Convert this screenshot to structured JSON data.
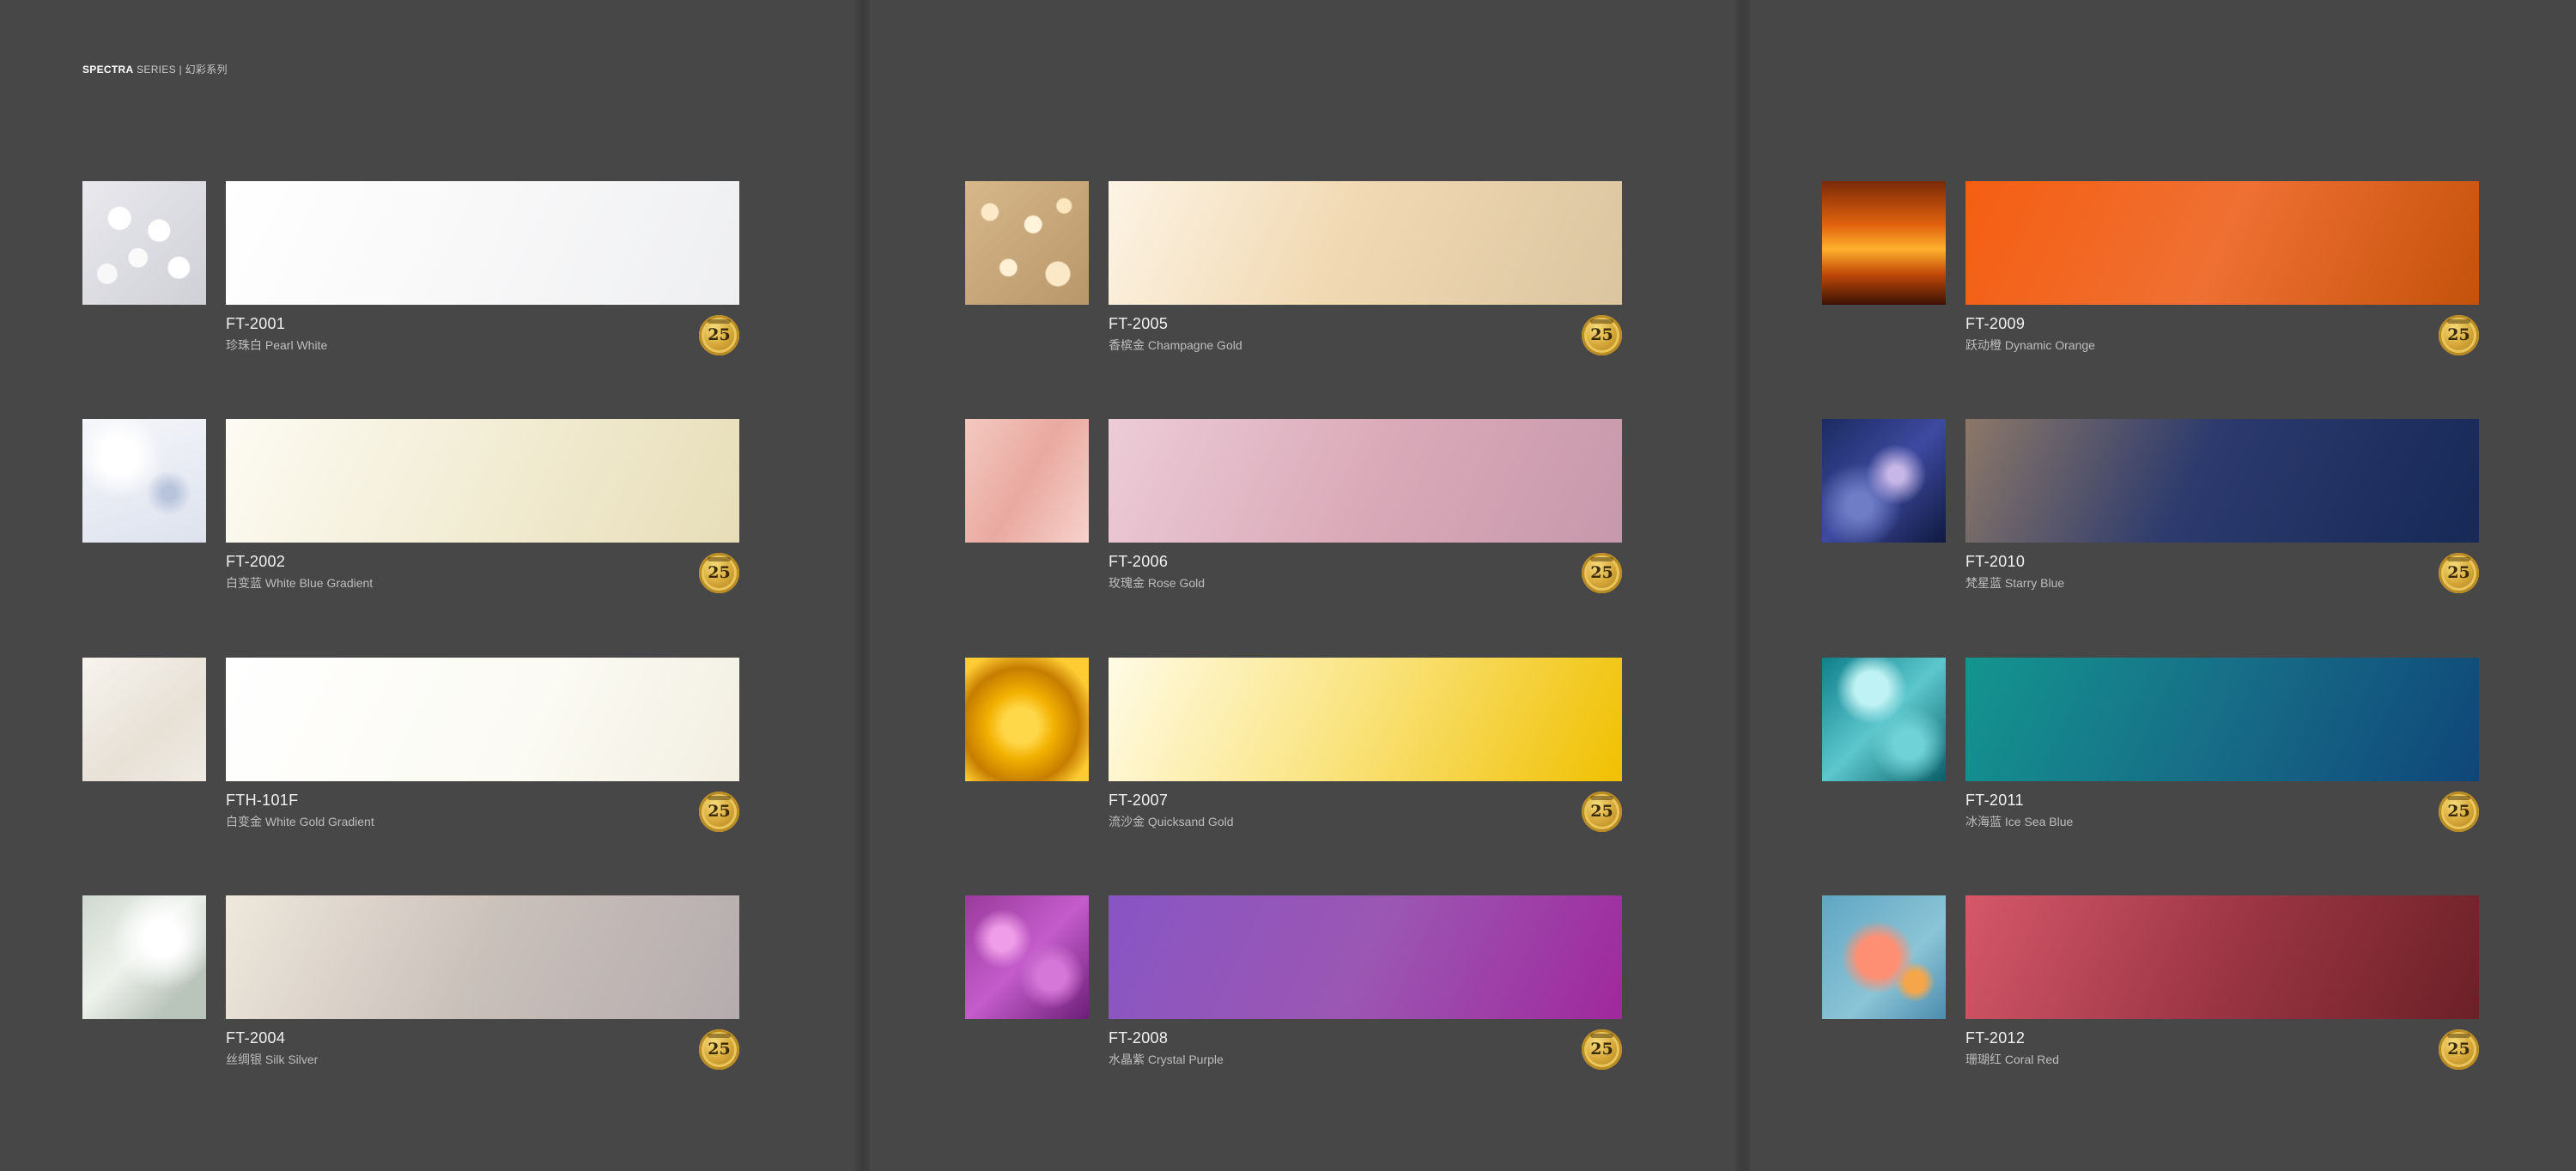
{
  "header": {
    "brand": "SPECTRA",
    "rest": "SERIES | 幻彩系列"
  },
  "badge_text": "25",
  "swatches": [
    {
      "code": "FT-2001",
      "name": "珍珠白 Pearl White",
      "colors": [
        "#ffffff",
        "#eeeff1"
      ]
    },
    {
      "code": "FT-2002",
      "name": "白变蓝 White Blue Gradient",
      "colors": [
        "#fdfbf3",
        "#e7ddb8"
      ]
    },
    {
      "code": "FTH-101F",
      "name": "白变金 White Gold Gradient",
      "colors": [
        "#ffffff",
        "#f2efe1"
      ]
    },
    {
      "code": "FT-2004",
      "name": "丝绸银 Silk Silver",
      "colors": [
        "#efe8dc",
        "#b5acae"
      ]
    },
    {
      "code": "FT-2005",
      "name": "香槟金 Champagne Gold",
      "colors": [
        "#fdf4e5",
        "#dac5a0"
      ]
    },
    {
      "code": "FT-2006",
      "name": "玫瑰金 Rose Gold",
      "colors": [
        "#ecccd7",
        "#c698ab"
      ]
    },
    {
      "code": "FT-2007",
      "name": "流沙金 Quicksand Gold",
      "colors": [
        "#fffbe6",
        "#f0c000"
      ]
    },
    {
      "code": "FT-2008",
      "name": "水晶紫 Crystal Purple",
      "colors": [
        "#8855c4",
        "#a0289c"
      ]
    },
    {
      "code": "FT-2009",
      "name": "跃动橙 Dynamic Orange",
      "colors": [
        "#f55e12",
        "#c4520b"
      ]
    },
    {
      "code": "FT-2010",
      "name": "梵星蓝 Starry Blue",
      "colors": [
        "#8c7868",
        "#162957"
      ]
    },
    {
      "code": "FT-2011",
      "name": "冰海蓝 Ice Sea Blue",
      "colors": [
        "#13958f",
        "#0f4679"
      ]
    },
    {
      "code": "FT-2012",
      "name": "珊瑚红 Coral Red",
      "colors": [
        "#d55869",
        "#6b2027"
      ]
    }
  ]
}
